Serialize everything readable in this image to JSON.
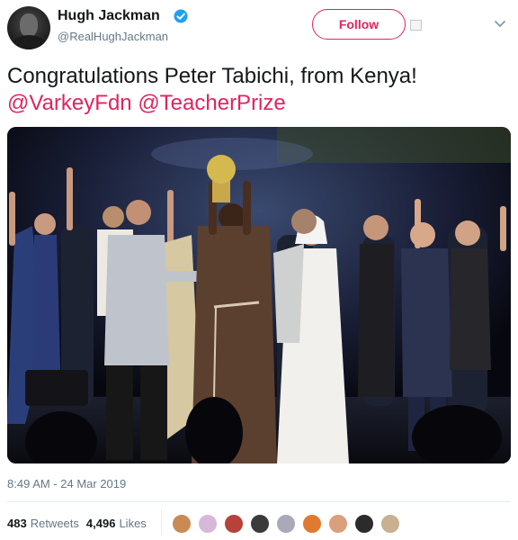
{
  "user": {
    "display_name": "Hugh Jackman",
    "handle": "@RealHughJackman"
  },
  "follow_label": "Follow",
  "tweet": {
    "text_line1": "Congratulations Peter Tabichi, from Kenya!",
    "mention1": "@VarkeyFdn",
    "mention2": "@TeacherPrize"
  },
  "timestamp": "8:49 AM - 24 Mar 2019",
  "stats": {
    "retweets_count": "483",
    "retweets_label": "Retweets",
    "likes_count": "4,496",
    "likes_label": "Likes"
  },
  "icons": {
    "verified": "verified-badge-icon",
    "chevron": "chevron-down-icon"
  },
  "colors": {
    "accent": "#e0245e",
    "verified": "#1da1f2",
    "muted": "#657786"
  },
  "liker_avatar_colors": [
    "#c98a55",
    "#d7b8d8",
    "#b8413a",
    "#3b3b3b",
    "#a9a9b9",
    "#e07a2e",
    "#d9a07c",
    "#2b2b2b",
    "#c8b090"
  ]
}
